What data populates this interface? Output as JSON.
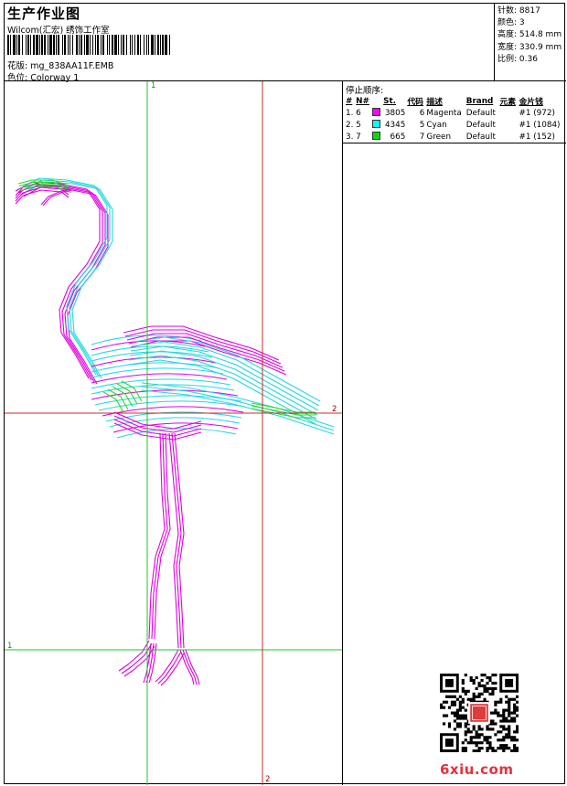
{
  "header": {
    "title": "生产作业图",
    "company": "Wilcom(汇宏) 绣饰工作室",
    "design_file_label": "花版:",
    "design_file": "mg_838AA11F.EMB",
    "colorway_label": "色位:",
    "colorway": "Colorway 1"
  },
  "stats": {
    "stitches_label": "针数:",
    "stitches": "8817",
    "colors_label": "颜色:",
    "colors": "3",
    "height_label": "高度:",
    "height": "514.8 mm",
    "width_label": "宽度:",
    "width": "330.9 mm",
    "scale_label": "比例:",
    "scale": "0.36"
  },
  "stop_sequence": {
    "title": "停止顺序:",
    "columns": [
      "#",
      "N#",
      "St.",
      "代码",
      "描述",
      "Brand",
      "元素",
      "金片钱"
    ],
    "rows": [
      {
        "idx": "1.",
        "n": "6",
        "color": "#ff00ff",
        "st": "3805",
        "code": "6",
        "desc": "Magenta",
        "brand": "Default",
        "element": "",
        "sequin": "#1 (972)"
      },
      {
        "idx": "2.",
        "n": "5",
        "color": "#00ffff",
        "st": "4345",
        "code": "5",
        "desc": "Cyan",
        "brand": "Default",
        "element": "",
        "sequin": "#1 (1084)"
      },
      {
        "idx": "3.",
        "n": "7",
        "color": "#00e000",
        "st": "665",
        "code": "7",
        "desc": "Green",
        "brand": "Default",
        "element": "",
        "sequin": "#1 (152)"
      }
    ]
  },
  "guides": {
    "v1": "1",
    "h2": "2",
    "h1": "1",
    "v2": "2",
    "green": "#22c422",
    "red": "#cc2a2a"
  },
  "thread_colors": {
    "magenta": "#e000e0",
    "cyan": "#22d8e0",
    "green": "#2ad82a"
  },
  "watermark": "6xiu.com"
}
